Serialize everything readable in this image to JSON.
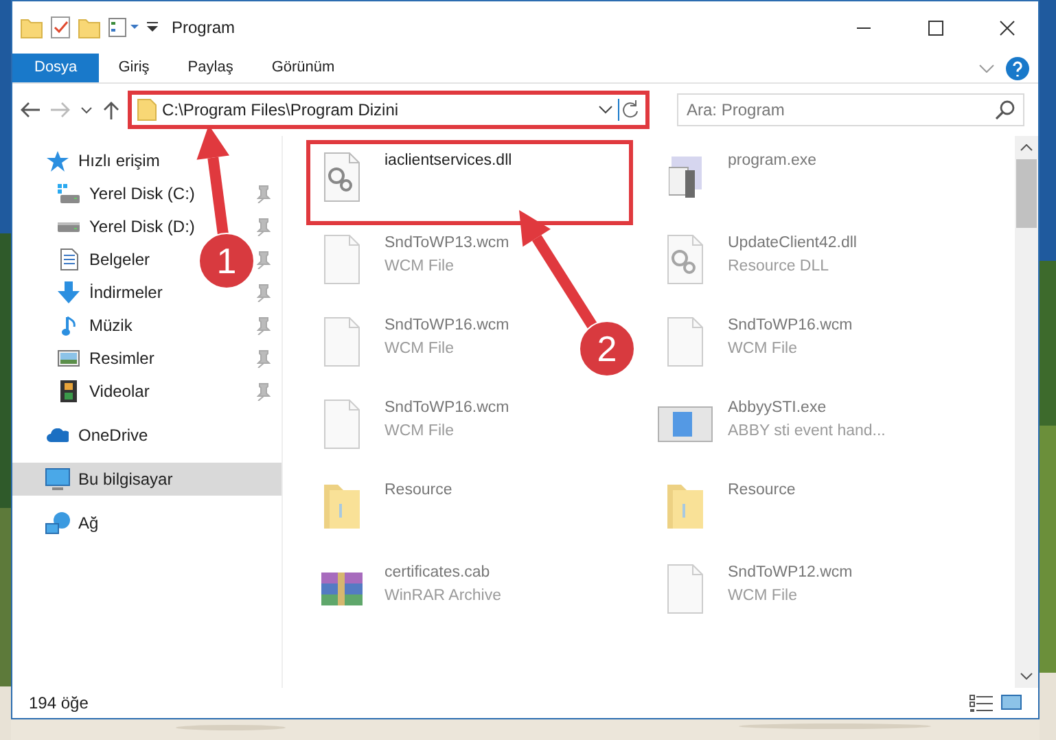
{
  "window": {
    "title": "Program"
  },
  "ribbon_tabs": [
    {
      "label": "Dosya",
      "selected": true
    },
    {
      "label": "Giriş",
      "selected": false
    },
    {
      "label": "Paylaş",
      "selected": false
    },
    {
      "label": "Görünüm",
      "selected": false
    }
  ],
  "address_bar": {
    "path": "C:\\Program Files\\Program Dizini",
    "highlighted": true
  },
  "search": {
    "placeholder": "Ara: Program"
  },
  "sidebar": {
    "items": [
      {
        "label": "Hızlı erişim",
        "kind": "star",
        "selected": false,
        "children": [
          {
            "label": "Yerel Disk (C:)",
            "kind": "disk-c",
            "pinned": true,
            "selected": false
          },
          {
            "label": "Yerel Disk (D:)",
            "kind": "disk",
            "pinned": true,
            "selected": false
          },
          {
            "label": "Belgeler",
            "kind": "document",
            "pinned": true,
            "selected": false
          },
          {
            "label": "İndirmeler",
            "kind": "download",
            "pinned": true,
            "selected": false
          },
          {
            "label": "Müzik",
            "kind": "music",
            "pinned": true,
            "selected": false
          },
          {
            "label": "Resimler",
            "pinned": true,
            "selected": false
          },
          {
            "label": "Videolar",
            "kind": "film",
            "pinned": true,
            "selected": false
          }
        ]
      },
      {
        "label": "OneDrive",
        "kind": "cloud",
        "selected": false
      },
      {
        "label": "Bu bilgisayar",
        "kind": "computer",
        "selected": true
      },
      {
        "label": "Ağ",
        "kind": "network",
        "selected": false
      }
    ]
  },
  "files": [
    {
      "name": "iaclientservices.dll",
      "kind": "dll",
      "blurred": false,
      "highlighted": true
    },
    {
      "name": "program.exe",
      "kind": "installer",
      "blurred": true,
      "highlighted": false
    },
    {
      "name": "SndToWP13.wcm",
      "type": "WCM File",
      "kind": "file",
      "blurred": true,
      "highlighted": false
    },
    {
      "name": "UpdateClient42.dll",
      "type": "Resource DLL",
      "kind": "dll",
      "blurred": true,
      "highlighted": false
    },
    {
      "name": "SndToWP16.wcm",
      "type": "WCM File",
      "kind": "file",
      "blurred": true,
      "highlighted": false
    },
    {
      "name": "SndToWP16.wcm",
      "type": "WCM File",
      "kind": "file",
      "blurred": true,
      "highlighted": false
    },
    {
      "name": "SndToWP16.wcm",
      "type": "WCM File",
      "kind": "file",
      "blurred": true,
      "highlighted": false
    },
    {
      "name": "AbbyySTI.exe",
      "type": "ABBY sti event hand...",
      "kind": "app",
      "blurred": true,
      "highlighted": false
    },
    {
      "name": "Resource",
      "kind": "folder",
      "blurred": true,
      "highlighted": false
    },
    {
      "name": "Resource",
      "kind": "folder",
      "blurred": true,
      "highlighted": false
    },
    {
      "name": "certificates.cab",
      "type": "WinRAR Archive",
      "kind": "archive",
      "blurred": true,
      "highlighted": false
    },
    {
      "name": "SndToWP12.wcm",
      "type": "WCM File",
      "kind": "file",
      "blurred": true,
      "highlighted": false
    }
  ],
  "status_bar": {
    "count": "194 öğe"
  },
  "markers": [
    {
      "label": "1"
    },
    {
      "label": "2"
    }
  ]
}
